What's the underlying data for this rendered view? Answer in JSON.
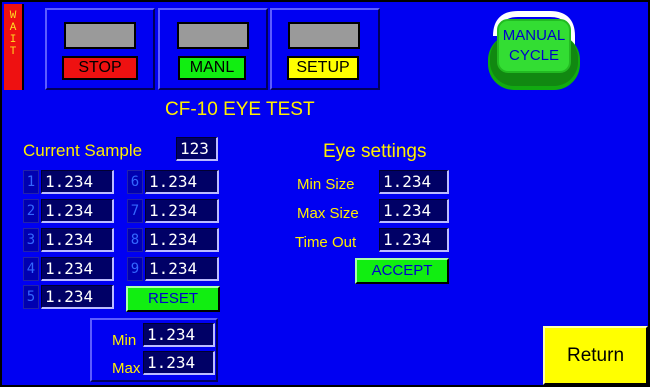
{
  "status_bar": {
    "wait_letters": [
      "W",
      "A",
      "I",
      "T"
    ]
  },
  "top_buttons": {
    "stop": {
      "label": "STOP",
      "color": "#ee1111"
    },
    "manl": {
      "label": "MANL",
      "color": "#11ee11"
    },
    "setup": {
      "label": "SETUP",
      "color": "#ffff00"
    }
  },
  "manual_cycle": {
    "line1": "MANUAL",
    "line2": "CYCLE"
  },
  "title": "CF-10 EYE TEST",
  "current_sample": {
    "label": "Current Sample",
    "value": "123"
  },
  "samples": [
    {
      "index": "1",
      "value": "1.234"
    },
    {
      "index": "2",
      "value": "1.234"
    },
    {
      "index": "3",
      "value": "1.234"
    },
    {
      "index": "4",
      "value": "1.234"
    },
    {
      "index": "5",
      "value": "1.234"
    },
    {
      "index": "6",
      "value": "1.234"
    },
    {
      "index": "7",
      "value": "1.234"
    },
    {
      "index": "8",
      "value": "1.234"
    },
    {
      "index": "9",
      "value": "1.234"
    }
  ],
  "reset_label": "RESET",
  "min_max": {
    "min_label": "Min",
    "min_value": "1.234",
    "max_label": "Max",
    "max_value": "1.234"
  },
  "eye_settings": {
    "heading": "Eye settings",
    "min_size_label": "Min Size",
    "min_size_value": "1.234",
    "max_size_label": "Max Size",
    "max_size_value": "1.234",
    "time_out_label": "Time Out",
    "time_out_value": "1.234",
    "accept_label": "ACCEPT"
  },
  "return_label": "Return",
  "colors": {
    "background": "#0000f2",
    "label_yellow": "#ffee00",
    "field": "#000066",
    "button_green": "#11ee11"
  }
}
